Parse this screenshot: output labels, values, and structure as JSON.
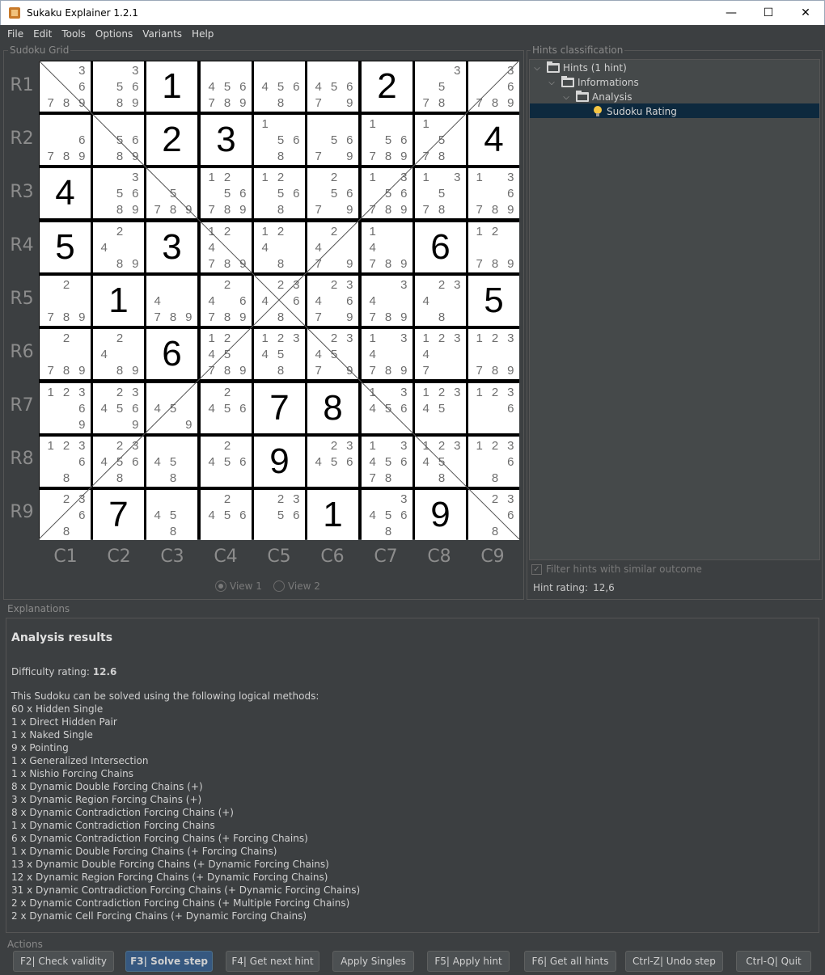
{
  "window": {
    "title": "Sukaku Explainer 1.2.1",
    "controls": [
      "—",
      "☐",
      "✕"
    ]
  },
  "menu": [
    "File",
    "Edit",
    "Tools",
    "Options",
    "Variants",
    "Help"
  ],
  "panels": {
    "grid_label": "Sudoku Grid",
    "hints_label": "Hints classification",
    "explanations_label": "Explanations",
    "actions_label": "Actions"
  },
  "grid": {
    "row_labels": [
      "R1",
      "R2",
      "R3",
      "R4",
      "R5",
      "R6",
      "R7",
      "R8",
      "R9"
    ],
    "col_labels": [
      "C1",
      "C2",
      "C3",
      "C4",
      "C5",
      "C6",
      "C7",
      "C8",
      "C9"
    ],
    "cells": [
      [
        "c:369789",
        "c:35689",
        "v:1",
        "c:456789",
        "c:4568",
        "c:45679",
        "v:2",
        "c:3578",
        "c:36789"
      ],
      [
        "c:6789",
        "c:5689",
        "v:2",
        "v:3",
        "c:1568",
        "c:5679",
        "c:156789",
        "c:1578",
        "v:4"
      ],
      [
        "v:4",
        "c:35689",
        "c:5789",
        "c:1256789",
        "c:12568",
        "c:25679",
        "c:1356789",
        "c:13578",
        "c:136789"
      ],
      [
        "v:5",
        "c:2489",
        "v:3",
        "c:124789",
        "c:1248",
        "c:2479",
        "c:14789",
        "v:6",
        "c:12789"
      ],
      [
        "c:2789",
        "v:1",
        "c:4789",
        "c:246789",
        "c:23468",
        "c:234679",
        "c:34789",
        "c:2348",
        "v:5"
      ],
      [
        "c:2789",
        "c:2489",
        "v:6",
        "c:1245789",
        "c:123458",
        "c:234579",
        "c:134789",
        "c:12347",
        "c:123789"
      ],
      [
        "c:12369",
        "c:234569",
        "c:459",
        "c:2456",
        "v:7",
        "v:8",
        "c:13456",
        "c:12345",
        "c:1236"
      ],
      [
        "c:12368",
        "c:234568",
        "c:458",
        "c:2456",
        "v:9",
        "c:23456",
        "c:1345678",
        "c:123458",
        "c:12368"
      ],
      [
        "c:2368",
        "v:7",
        "c:458",
        "c:2456",
        "c:2356",
        "v:1",
        "c:34568",
        "v:9",
        "c:2368"
      ]
    ]
  },
  "views": {
    "view1": "View 1",
    "view2": "View 2"
  },
  "tree": {
    "nodes": [
      {
        "label": "Hints (1 hint)",
        "icon": "folder-open-icon"
      },
      {
        "label": "Informations",
        "icon": "folder-open-icon"
      },
      {
        "label": "Analysis",
        "icon": "folder-open-icon"
      },
      {
        "label": "Sudoku Rating",
        "icon": "bulb-icon"
      }
    ]
  },
  "filter": {
    "label": "Filter hints with similar outcome",
    "checked": true
  },
  "hint_rating": {
    "label": "Hint rating:",
    "value": "12,6"
  },
  "explanation": {
    "heading": "Analysis results",
    "difficulty_label": "Difficulty rating:",
    "difficulty_value": "12.6",
    "intro": "This Sudoku can be solved using the following logical methods:",
    "methods": [
      "60 x Hidden Single",
      "1 x Direct Hidden Pair",
      "1 x Naked Single",
      "9 x Pointing",
      "1 x Generalized Intersection",
      "1 x Nishio Forcing Chains",
      "8 x Dynamic Double Forcing Chains (+)",
      "3 x Dynamic Region Forcing Chains (+)",
      "8 x Dynamic Contradiction Forcing Chains (+)",
      "1 x Dynamic Contradiction Forcing Chains",
      "6 x Dynamic Contradiction Forcing Chains (+ Forcing Chains)",
      "1 x Dynamic Double Forcing Chains (+ Forcing Chains)",
      "13 x Dynamic Double Forcing Chains (+ Dynamic Forcing Chains)",
      "12 x Dynamic Region Forcing Chains (+ Dynamic Forcing Chains)",
      "31 x Dynamic Contradiction Forcing Chains (+ Dynamic Forcing Chains)",
      "2 x Dynamic Contradiction Forcing Chains (+ Multiple Forcing Chains)",
      "2 x Dynamic Cell Forcing Chains (+ Dynamic Forcing Chains)"
    ]
  },
  "actions": [
    {
      "label": "F2| Check validity",
      "default": false
    },
    {
      "label": "F3| Solve step",
      "default": true
    },
    {
      "label": "F4| Get next hint",
      "default": false
    },
    {
      "label": "Apply Singles",
      "default": false
    },
    {
      "label": "F5| Apply hint",
      "default": false
    },
    {
      "label": "F6| Get all hints",
      "default": false
    },
    {
      "label": "Ctrl-Z| Undo step",
      "default": false
    },
    {
      "label": "Ctrl-Q| Quit",
      "default": false
    }
  ]
}
